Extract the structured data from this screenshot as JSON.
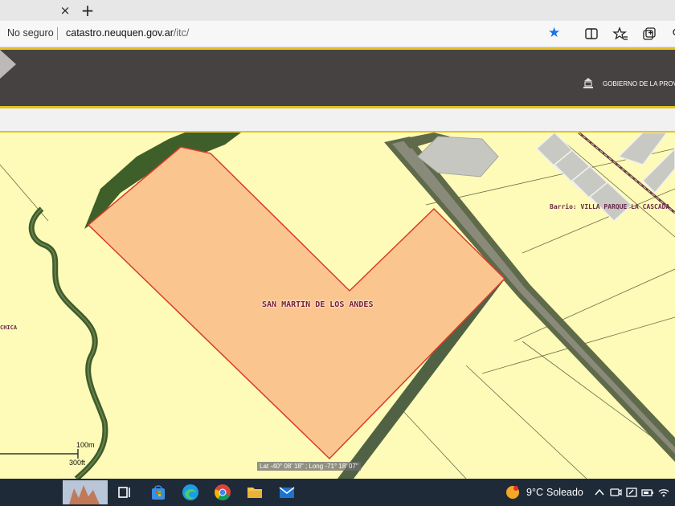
{
  "browser": {
    "tab_close": "×",
    "new_tab": "+",
    "security_label": "No seguro",
    "url_host": "catastro.neuquen.gov.ar",
    "url_path": "/itc/"
  },
  "site": {
    "header_text": "GOBIERNO DE LA PROVIN"
  },
  "map": {
    "parcel_label": "SAN MARTIN DE LOS ANDES",
    "barrio_label": "Barrio: VILLA PARQUE LA CASCADA",
    "left_label": "CHICA",
    "scale_metric": "100m",
    "scale_imperial": "300ft",
    "coordinates": "Lat -40° 08' 18\" ; Long -71° 18' 07\""
  },
  "taskbar": {
    "temperature": "9°C",
    "condition": "Soleado"
  },
  "colors": {
    "parcel_fill": "#fbc58f",
    "parcel_border": "#d93a2a",
    "map_background": "#fdfbb7",
    "header_background": "#474242",
    "header_accent": "#e8c11c"
  }
}
